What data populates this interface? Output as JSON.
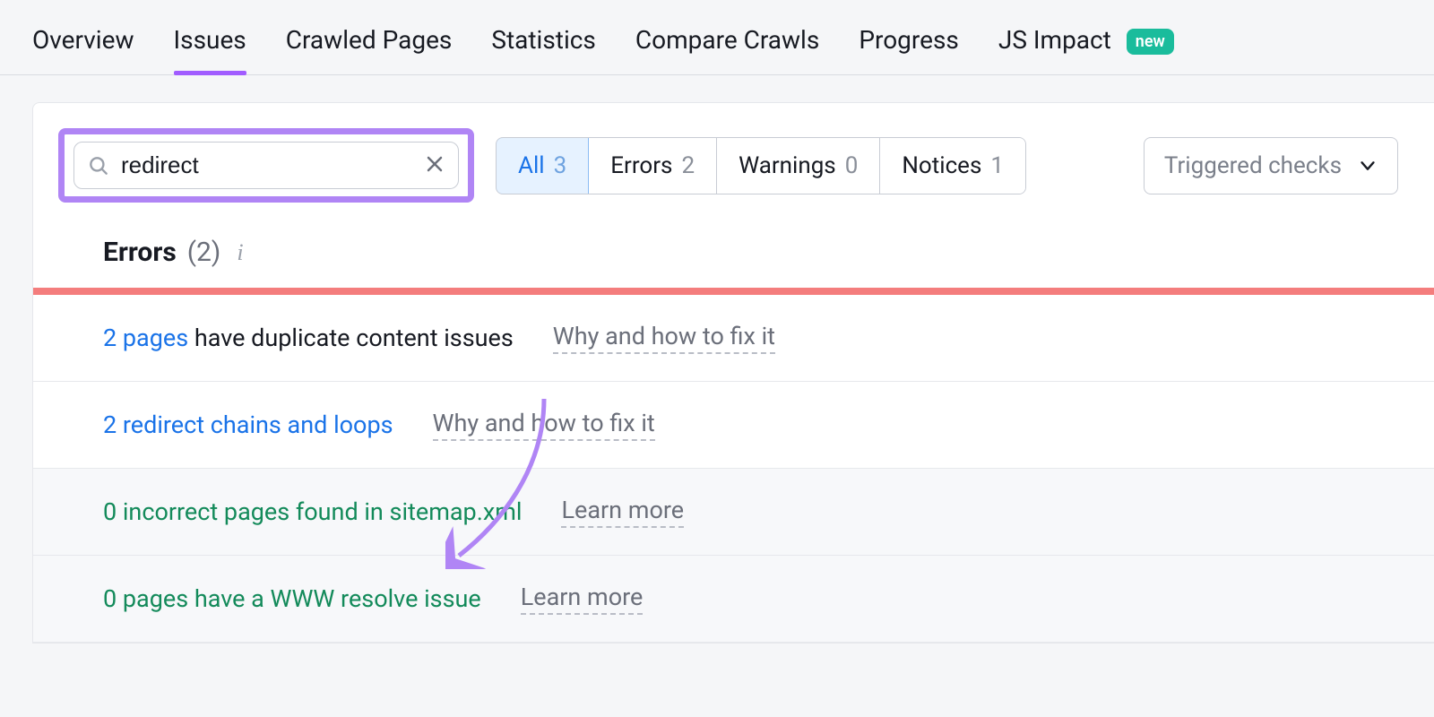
{
  "tabs": {
    "overview": "Overview",
    "issues": "Issues",
    "crawled": "Crawled Pages",
    "stats": "Statistics",
    "compare": "Compare Crawls",
    "progress": "Progress",
    "jsimpact": "JS Impact",
    "new_badge": "new"
  },
  "search": {
    "value": "redirect"
  },
  "filters": {
    "all": {
      "label": "All",
      "count": "3"
    },
    "errors": {
      "label": "Errors",
      "count": "2"
    },
    "warnings": {
      "label": "Warnings",
      "count": "0"
    },
    "notices": {
      "label": "Notices",
      "count": "1"
    }
  },
  "dropdown": {
    "label": "Triggered checks"
  },
  "section": {
    "title": "Errors",
    "count": "(2)"
  },
  "rows": [
    {
      "link": "2 pages",
      "rest": " have duplicate content issues",
      "fix": "Why and how to fix it",
      "cls": "link-blue",
      "dim": false
    },
    {
      "link": "2 redirect chains and loops",
      "rest": "",
      "fix": "Why and how to fix it",
      "cls": "link-blue",
      "dim": false
    },
    {
      "link": "0 incorrect pages found in sitemap.xml",
      "rest": "",
      "fix": "Learn more",
      "cls": "link-green",
      "dim": true
    },
    {
      "link": "0 pages have a WWW resolve issue",
      "rest": "",
      "fix": "Learn more",
      "cls": "link-green",
      "dim": true
    }
  ]
}
